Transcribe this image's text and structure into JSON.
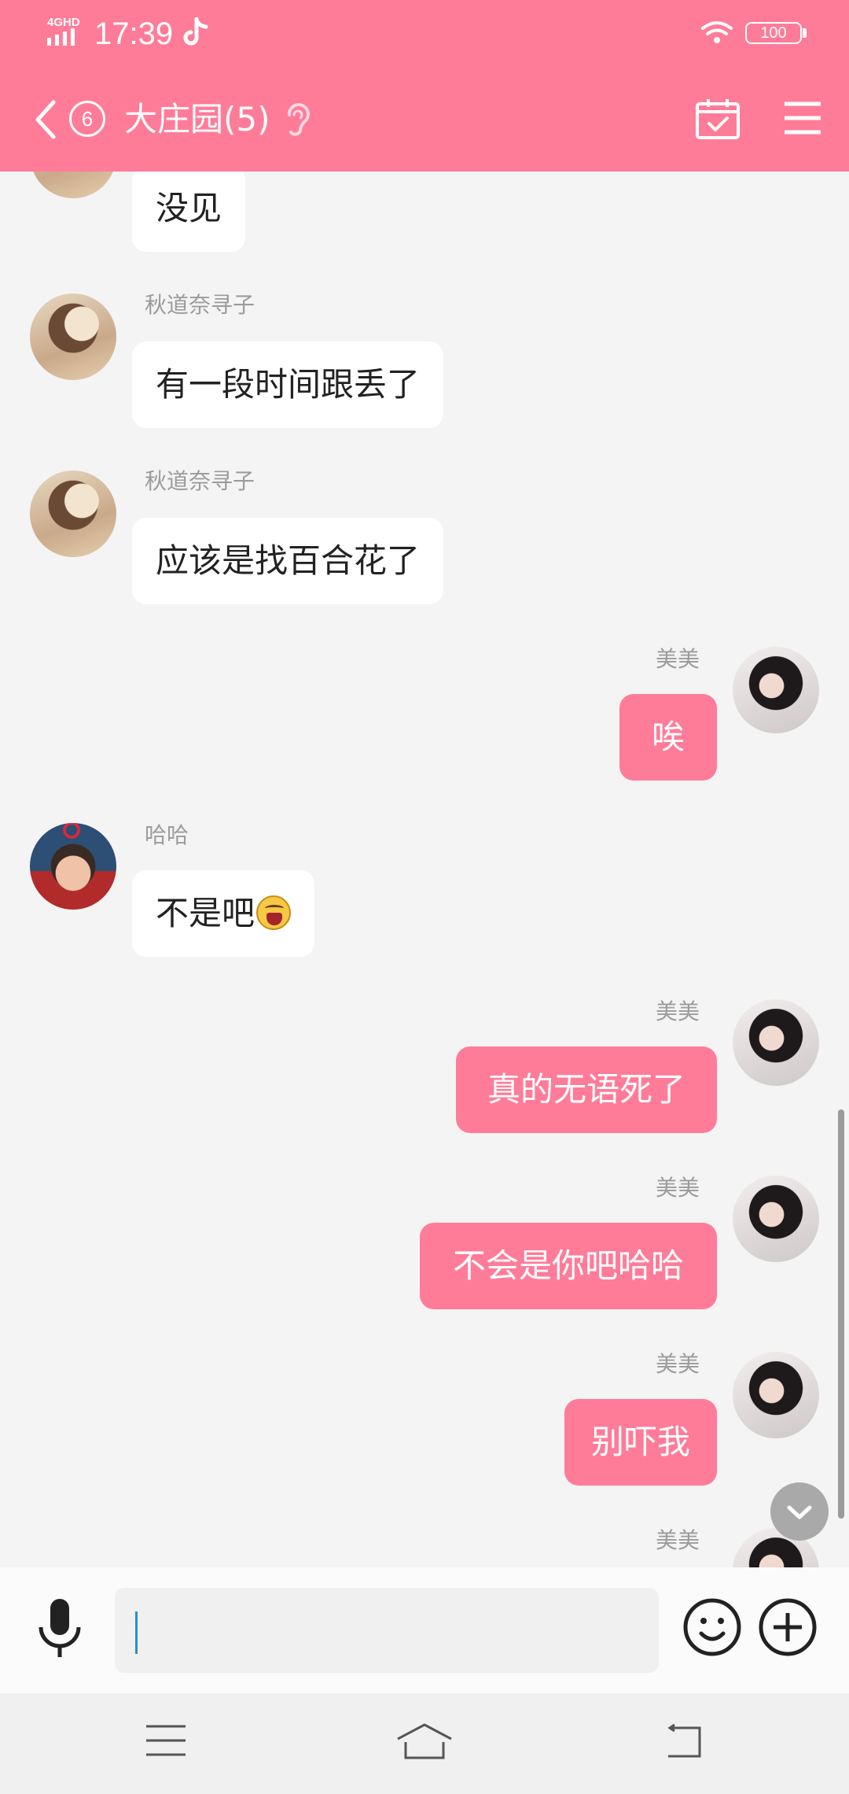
{
  "status_bar": {
    "network": "4GHD",
    "time": "17:39",
    "battery": "100"
  },
  "header": {
    "unread_count": "6",
    "title": "大庄园(5)"
  },
  "messages": [
    {
      "side": "in",
      "sender": "",
      "text": "没见"
    },
    {
      "side": "in",
      "sender": "秋道奈寻子",
      "text": "有一段时间跟丢了"
    },
    {
      "side": "in",
      "sender": "秋道奈寻子",
      "text": "应该是找百合花了"
    },
    {
      "side": "out",
      "sender": "美美",
      "text": "唉"
    },
    {
      "side": "in",
      "sender": "哈哈",
      "text": "不是吧"
    },
    {
      "side": "out",
      "sender": "美美",
      "text": "真的无语死了"
    },
    {
      "side": "out",
      "sender": "美美",
      "text": "不会是你吧哈哈"
    },
    {
      "side": "out",
      "sender": "美美",
      "text": "别吓我"
    },
    {
      "side": "out",
      "sender": "美美",
      "text": ""
    }
  ],
  "input": {
    "value": "",
    "placeholder": ""
  },
  "colors": {
    "accent": "#ff7c99",
    "background": "#f4f4f4",
    "bubble_in": "#ffffff"
  },
  "icons": {
    "status": [
      "signal-icon",
      "tiktok-icon",
      "wifi-icon",
      "battery-icon"
    ],
    "header": [
      "back-icon",
      "ear-icon",
      "calendar-check-icon",
      "menu-icon"
    ],
    "input": [
      "microphone-icon",
      "smiley-icon",
      "plus-circle-icon"
    ],
    "nav": [
      "nav-menu-icon",
      "nav-home-icon",
      "nav-back-icon"
    ],
    "chat": [
      "chevron-down-icon",
      "laughing-emoji-icon"
    ]
  }
}
